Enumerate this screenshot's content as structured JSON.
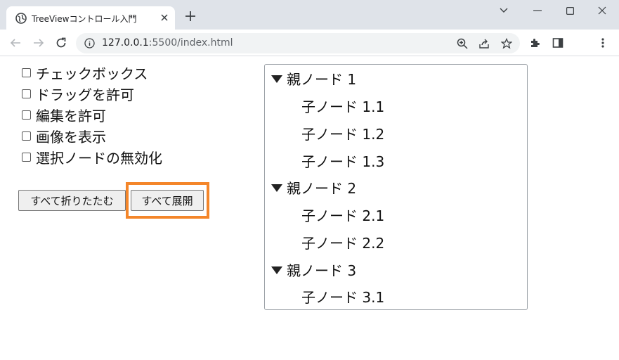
{
  "browser": {
    "tab_title": "TreeViewコントロール入門",
    "url_host": "127.0.0.1",
    "url_rest": ":5500/index.html"
  },
  "options": [
    {
      "label": "チェックボックス",
      "checked": false
    },
    {
      "label": "ドラッグを許可",
      "checked": false
    },
    {
      "label": "編集を許可",
      "checked": false
    },
    {
      "label": "画像を表示",
      "checked": false
    },
    {
      "label": "選択ノードの無効化",
      "checked": false
    }
  ],
  "buttons": {
    "collapse_all": "すべて折りたたむ",
    "expand_all": "すべて展開"
  },
  "tree": [
    {
      "label": "親ノード 1",
      "expanded": true,
      "children": [
        "子ノード 1.1",
        "子ノード 1.2",
        "子ノード 1.3"
      ]
    },
    {
      "label": "親ノード 2",
      "expanded": true,
      "children": [
        "子ノード 2.1",
        "子ノード 2.2"
      ]
    },
    {
      "label": "親ノード 3",
      "expanded": true,
      "children": [
        "子ノード 3.1"
      ]
    }
  ],
  "colors": {
    "highlight": "#f4862a",
    "chrome": "#dfe3e9"
  }
}
